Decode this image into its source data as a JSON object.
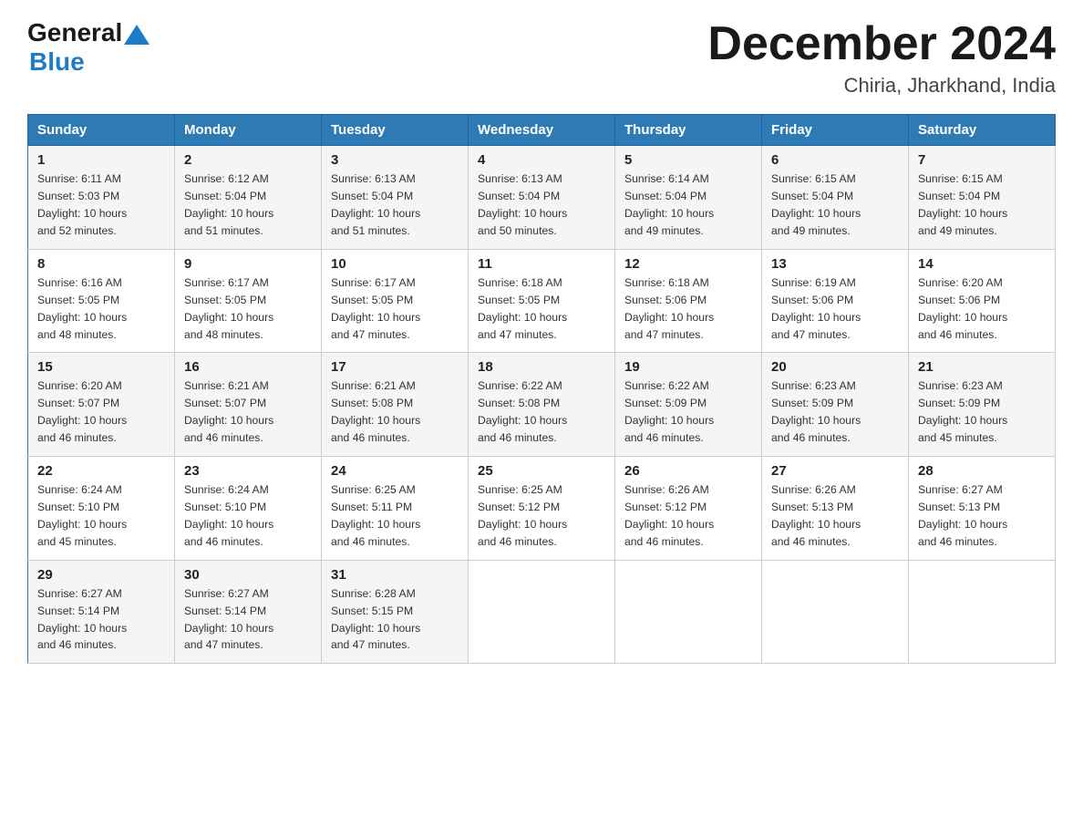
{
  "logo": {
    "general": "General",
    "blue": "Blue"
  },
  "title": "December 2024",
  "subtitle": "Chiria, Jharkhand, India",
  "weekdays": [
    "Sunday",
    "Monday",
    "Tuesday",
    "Wednesday",
    "Thursday",
    "Friday",
    "Saturday"
  ],
  "weeks": [
    [
      {
        "day": "1",
        "sunrise": "Sunrise: 6:11 AM",
        "sunset": "Sunset: 5:03 PM",
        "daylight": "Daylight: 10 hours",
        "daylight2": "and 52 minutes."
      },
      {
        "day": "2",
        "sunrise": "Sunrise: 6:12 AM",
        "sunset": "Sunset: 5:04 PM",
        "daylight": "Daylight: 10 hours",
        "daylight2": "and 51 minutes."
      },
      {
        "day": "3",
        "sunrise": "Sunrise: 6:13 AM",
        "sunset": "Sunset: 5:04 PM",
        "daylight": "Daylight: 10 hours",
        "daylight2": "and 51 minutes."
      },
      {
        "day": "4",
        "sunrise": "Sunrise: 6:13 AM",
        "sunset": "Sunset: 5:04 PM",
        "daylight": "Daylight: 10 hours",
        "daylight2": "and 50 minutes."
      },
      {
        "day": "5",
        "sunrise": "Sunrise: 6:14 AM",
        "sunset": "Sunset: 5:04 PM",
        "daylight": "Daylight: 10 hours",
        "daylight2": "and 49 minutes."
      },
      {
        "day": "6",
        "sunrise": "Sunrise: 6:15 AM",
        "sunset": "Sunset: 5:04 PM",
        "daylight": "Daylight: 10 hours",
        "daylight2": "and 49 minutes."
      },
      {
        "day": "7",
        "sunrise": "Sunrise: 6:15 AM",
        "sunset": "Sunset: 5:04 PM",
        "daylight": "Daylight: 10 hours",
        "daylight2": "and 49 minutes."
      }
    ],
    [
      {
        "day": "8",
        "sunrise": "Sunrise: 6:16 AM",
        "sunset": "Sunset: 5:05 PM",
        "daylight": "Daylight: 10 hours",
        "daylight2": "and 48 minutes."
      },
      {
        "day": "9",
        "sunrise": "Sunrise: 6:17 AM",
        "sunset": "Sunset: 5:05 PM",
        "daylight": "Daylight: 10 hours",
        "daylight2": "and 48 minutes."
      },
      {
        "day": "10",
        "sunrise": "Sunrise: 6:17 AM",
        "sunset": "Sunset: 5:05 PM",
        "daylight": "Daylight: 10 hours",
        "daylight2": "and 47 minutes."
      },
      {
        "day": "11",
        "sunrise": "Sunrise: 6:18 AM",
        "sunset": "Sunset: 5:05 PM",
        "daylight": "Daylight: 10 hours",
        "daylight2": "and 47 minutes."
      },
      {
        "day": "12",
        "sunrise": "Sunrise: 6:18 AM",
        "sunset": "Sunset: 5:06 PM",
        "daylight": "Daylight: 10 hours",
        "daylight2": "and 47 minutes."
      },
      {
        "day": "13",
        "sunrise": "Sunrise: 6:19 AM",
        "sunset": "Sunset: 5:06 PM",
        "daylight": "Daylight: 10 hours",
        "daylight2": "and 47 minutes."
      },
      {
        "day": "14",
        "sunrise": "Sunrise: 6:20 AM",
        "sunset": "Sunset: 5:06 PM",
        "daylight": "Daylight: 10 hours",
        "daylight2": "and 46 minutes."
      }
    ],
    [
      {
        "day": "15",
        "sunrise": "Sunrise: 6:20 AM",
        "sunset": "Sunset: 5:07 PM",
        "daylight": "Daylight: 10 hours",
        "daylight2": "and 46 minutes."
      },
      {
        "day": "16",
        "sunrise": "Sunrise: 6:21 AM",
        "sunset": "Sunset: 5:07 PM",
        "daylight": "Daylight: 10 hours",
        "daylight2": "and 46 minutes."
      },
      {
        "day": "17",
        "sunrise": "Sunrise: 6:21 AM",
        "sunset": "Sunset: 5:08 PM",
        "daylight": "Daylight: 10 hours",
        "daylight2": "and 46 minutes."
      },
      {
        "day": "18",
        "sunrise": "Sunrise: 6:22 AM",
        "sunset": "Sunset: 5:08 PM",
        "daylight": "Daylight: 10 hours",
        "daylight2": "and 46 minutes."
      },
      {
        "day": "19",
        "sunrise": "Sunrise: 6:22 AM",
        "sunset": "Sunset: 5:09 PM",
        "daylight": "Daylight: 10 hours",
        "daylight2": "and 46 minutes."
      },
      {
        "day": "20",
        "sunrise": "Sunrise: 6:23 AM",
        "sunset": "Sunset: 5:09 PM",
        "daylight": "Daylight: 10 hours",
        "daylight2": "and 46 minutes."
      },
      {
        "day": "21",
        "sunrise": "Sunrise: 6:23 AM",
        "sunset": "Sunset: 5:09 PM",
        "daylight": "Daylight: 10 hours",
        "daylight2": "and 45 minutes."
      }
    ],
    [
      {
        "day": "22",
        "sunrise": "Sunrise: 6:24 AM",
        "sunset": "Sunset: 5:10 PM",
        "daylight": "Daylight: 10 hours",
        "daylight2": "and 45 minutes."
      },
      {
        "day": "23",
        "sunrise": "Sunrise: 6:24 AM",
        "sunset": "Sunset: 5:10 PM",
        "daylight": "Daylight: 10 hours",
        "daylight2": "and 46 minutes."
      },
      {
        "day": "24",
        "sunrise": "Sunrise: 6:25 AM",
        "sunset": "Sunset: 5:11 PM",
        "daylight": "Daylight: 10 hours",
        "daylight2": "and 46 minutes."
      },
      {
        "day": "25",
        "sunrise": "Sunrise: 6:25 AM",
        "sunset": "Sunset: 5:12 PM",
        "daylight": "Daylight: 10 hours",
        "daylight2": "and 46 minutes."
      },
      {
        "day": "26",
        "sunrise": "Sunrise: 6:26 AM",
        "sunset": "Sunset: 5:12 PM",
        "daylight": "Daylight: 10 hours",
        "daylight2": "and 46 minutes."
      },
      {
        "day": "27",
        "sunrise": "Sunrise: 6:26 AM",
        "sunset": "Sunset: 5:13 PM",
        "daylight": "Daylight: 10 hours",
        "daylight2": "and 46 minutes."
      },
      {
        "day": "28",
        "sunrise": "Sunrise: 6:27 AM",
        "sunset": "Sunset: 5:13 PM",
        "daylight": "Daylight: 10 hours",
        "daylight2": "and 46 minutes."
      }
    ],
    [
      {
        "day": "29",
        "sunrise": "Sunrise: 6:27 AM",
        "sunset": "Sunset: 5:14 PM",
        "daylight": "Daylight: 10 hours",
        "daylight2": "and 46 minutes."
      },
      {
        "day": "30",
        "sunrise": "Sunrise: 6:27 AM",
        "sunset": "Sunset: 5:14 PM",
        "daylight": "Daylight: 10 hours",
        "daylight2": "and 47 minutes."
      },
      {
        "day": "31",
        "sunrise": "Sunrise: 6:28 AM",
        "sunset": "Sunset: 5:15 PM",
        "daylight": "Daylight: 10 hours",
        "daylight2": "and 47 minutes."
      },
      {
        "day": "",
        "sunrise": "",
        "sunset": "",
        "daylight": "",
        "daylight2": ""
      },
      {
        "day": "",
        "sunrise": "",
        "sunset": "",
        "daylight": "",
        "daylight2": ""
      },
      {
        "day": "",
        "sunrise": "",
        "sunset": "",
        "daylight": "",
        "daylight2": ""
      },
      {
        "day": "",
        "sunrise": "",
        "sunset": "",
        "daylight": "",
        "daylight2": ""
      }
    ]
  ]
}
